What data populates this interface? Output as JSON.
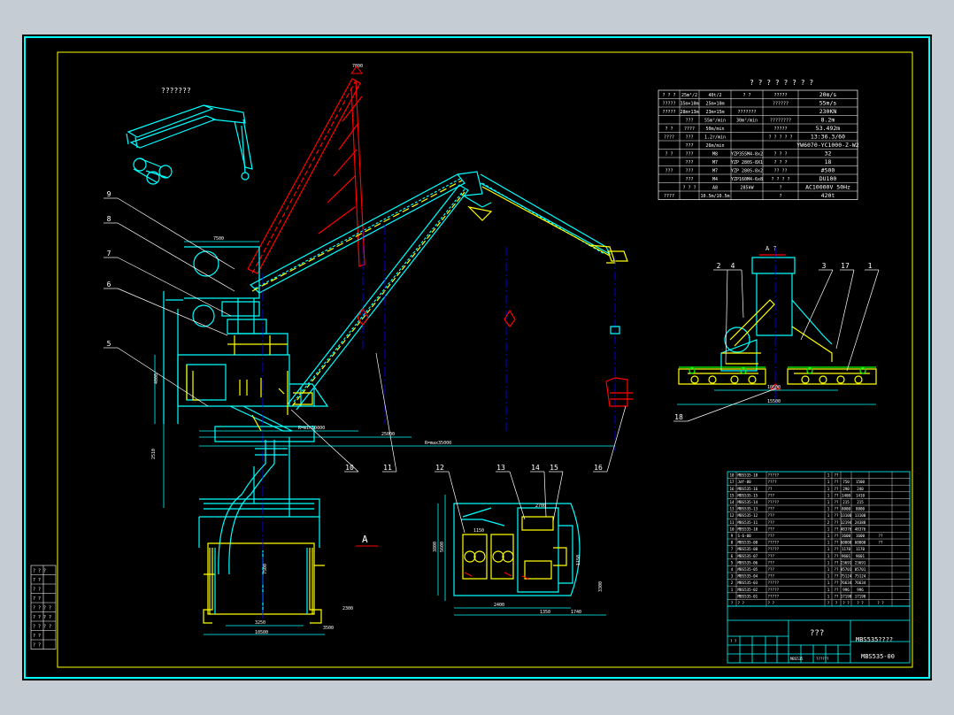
{
  "colors": {
    "app_background": "#c6ccd4",
    "canvas": "#000000",
    "border": "#00ffff",
    "inner_frame": "#ffff00",
    "hull": "#00ffff",
    "hull_alt": "#ffff00",
    "boom_raised": "#ff0000",
    "centerline": "#0000ff",
    "dimension": "#00ffff",
    "leader": "#ffffff",
    "marker": "#ff0000"
  },
  "spec_table": {
    "title": "? ? ? ? ? ? ? ?",
    "rows": [
      [
        "? ? ?",
        "25m²/2",
        "40t/2",
        "? ?",
        "?????",
        "20m/s"
      ],
      [
        "?????",
        "35m×10m",
        "25m×10m",
        "",
        "??????",
        "55m/s"
      ],
      [
        "?????",
        "28m×13m",
        "23m×15m",
        "???????",
        "",
        "230KN"
      ],
      [
        "",
        "???",
        "55m³/min",
        "30m³/min",
        "????????",
        "8.2m"
      ],
      [
        "? ?",
        "????",
        "50m/min",
        "",
        "?????",
        "53.492m"
      ],
      [
        "????",
        "???",
        "1.2r/min",
        "",
        "? ? ? ? ?",
        "13:36.3/60"
      ],
      [
        "",
        "???",
        "26m/min",
        "",
        "",
        "YW6070-YC1000-Z-W2"
      ],
      [
        "? ?",
        "???",
        "M8",
        "YZP355M4-8x2",
        "? ? ?",
        "32"
      ],
      [
        "",
        "???",
        "M7",
        "YZP 280S-8X1",
        "? ? ?",
        "18"
      ],
      [
        "???",
        "???",
        "M7",
        "YZP 280S-8x2",
        "?? ??",
        "#500"
      ],
      [
        "",
        "???",
        "M4",
        "YZP160M4-6x8",
        "? ? ? ?",
        "DU100"
      ],
      [
        "",
        "? ? ?",
        "A8",
        "285kW",
        "?",
        "AC10000V 50Hz"
      ],
      [
        "????",
        "",
        "10.5m/10.5m",
        "",
        "?",
        "420t"
      ]
    ]
  },
  "parts_list": {
    "rows": [
      [
        "18",
        "MBS535-18",
        "?????",
        "1",
        "??",
        "",
        "",
        ""
      ],
      [
        "17",
        "Jdf-00",
        "????",
        "1",
        "??",
        "750",
        "1500",
        ""
      ],
      [
        "16",
        "MBS535-16",
        "??",
        "1",
        "??",
        "290",
        "240",
        ""
      ],
      [
        "15",
        "MBS535-15",
        "???",
        "1",
        "??",
        "1400",
        "1410",
        ""
      ],
      [
        "14",
        "MBS535-14",
        "?????",
        "1",
        "??",
        "215",
        "215",
        ""
      ],
      [
        "13",
        "MBS535-13",
        "???",
        "1",
        "??",
        "8000",
        "8000",
        ""
      ],
      [
        "12",
        "MBS535-12",
        "???",
        "1",
        "??",
        "13100",
        "13100",
        ""
      ],
      [
        "11",
        "MBS535-11",
        "???",
        "2",
        "??",
        "12194",
        "24388",
        ""
      ],
      [
        "10",
        "MBS535-10",
        "???",
        "1",
        "??",
        "48376",
        "48376",
        ""
      ],
      [
        "9",
        "S-6-00",
        "???",
        "1",
        "??",
        "1600",
        "1600",
        "??"
      ],
      [
        "8",
        "MBS535-08",
        "?????",
        "1",
        "??",
        "60800",
        "60800",
        "??"
      ],
      [
        "7",
        "MBS535-08",
        "?????",
        "1",
        "??",
        "1170",
        "1170",
        ""
      ],
      [
        "6",
        "MBS535-07",
        "???",
        "1",
        "??",
        "9601",
        "9601",
        ""
      ],
      [
        "5",
        "MBS535-06",
        "???",
        "1",
        "??",
        "23691",
        "23691",
        ""
      ],
      [
        "4",
        "MBS535-05",
        "???",
        "1",
        "??",
        "85701",
        "85701",
        ""
      ],
      [
        "3",
        "MBS535-04",
        "???",
        "1",
        "??",
        "75124",
        "75124",
        ""
      ],
      [
        "2",
        "MBS535-03",
        "?????",
        "1",
        "??",
        "76634",
        "76634",
        ""
      ],
      [
        "1",
        "MBS535-02",
        "?????",
        "1",
        "??",
        "996",
        "996",
        ""
      ],
      [
        "",
        "MBS535-01",
        "?????",
        "1",
        "??",
        "17198",
        "17198",
        ""
      ],
      [
        "?",
        "? ?",
        "? ?",
        "?",
        "?",
        "? ?",
        "? ?",
        "? ?"
      ]
    ]
  },
  "title_block": {
    "name": "???",
    "drawing_title": "MBS535????",
    "drawing_number": "MBS535-00",
    "mark_1": "? ?",
    "mark_2": "MBS535",
    "mark_3": "??????"
  },
  "left_strip": {
    "rows": [
      "? ? ?",
      "? ?",
      "? ?",
      "? ?",
      "? ? ? ?",
      "? ? ? ?",
      "? ? ? ?",
      "? ?",
      "? ?"
    ]
  },
  "views": {
    "isometric_title": "???????",
    "side_view_title": "A ?",
    "section_letter": "A"
  },
  "balloons": [
    "1",
    "2",
    "3",
    "4",
    "5",
    "6",
    "7",
    "8",
    "9",
    "10",
    "11",
    "12",
    "13",
    "14",
    "15",
    "16",
    "17",
    "18"
  ],
  "dimensions": {
    "cab_width": "7500",
    "boom_radius_1": "R=min10000",
    "boom_radius_2": "25000",
    "boom_radius_3": "R=max35000",
    "left_height": "4000",
    "left_height_2": "3500",
    "portal_height": "2510",
    "tower_height": "7500",
    "pad_lower": "3500",
    "pad_width": "3250",
    "base_span": "10500",
    "rail_height": "2300",
    "side_track_width": "10500",
    "side_track_gauge": "15500",
    "plan_length": "5600",
    "plan_width": "3800",
    "plan_dim_a": "1150",
    "plan_dim_b": "1350",
    "plan_dim_c": "1740",
    "plan_dim_d": "2400",
    "plan_dim_e": "2700",
    "plan_dim_f": "1150",
    "plan_dim_g": "3300",
    "top_tip": "7800",
    "tip_mark": "1"
  }
}
